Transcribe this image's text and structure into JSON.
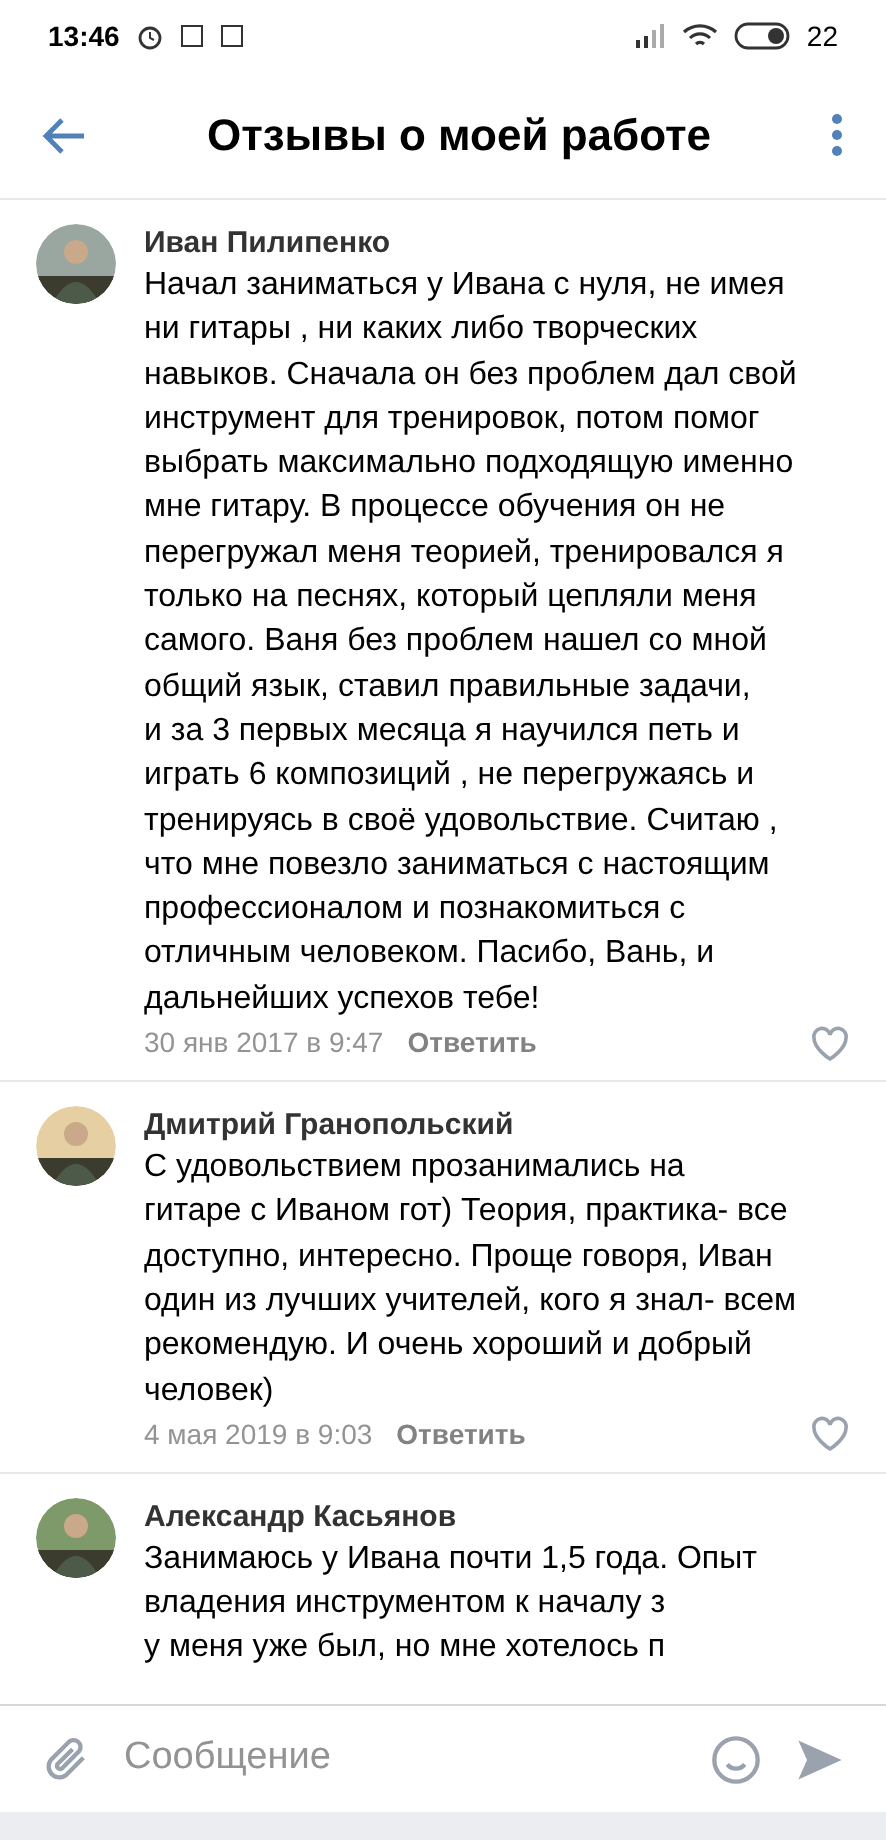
{
  "status_bar": {
    "time": "13:46",
    "battery": "22"
  },
  "header": {
    "title": "Отзывы о моей работе"
  },
  "comments": [
    {
      "author": "Иван Пилипенко",
      "lines": [
        "Начал заниматься у Ивана с нуля, не имея",
        "ни гитары , ни каких либо творческих",
        "навыков. Сначала он без проблем дал свой",
        "инструмент для тренировок, потом помог",
        "выбрать максимально подходящую именно",
        "мне гитару. В процессе обучения он не",
        "перегружал меня теорией, тренировался я",
        "только на песнях, который цепляли меня",
        "самого. Ваня без проблем нашел со мной",
        "общий язык, ставил правильные задачи,",
        "и за 3 первых месяца я научился петь и",
        "играть 6 композиций , не перегружаясь и",
        "тренируясь в своё удовольствие.  Считаю ,",
        "что мне повезло заниматься с настоящим",
        "профессионалом и познакомиться с",
        "отличным человеком. Пасибо, Вань, и",
        "дальнейших успехов тебе!"
      ],
      "date": "30 янв 2017 в 9:47",
      "reply": "Ответить",
      "liked": false
    },
    {
      "author": "Дмитрий Гранопольский",
      "lines": [
        "С удовольствием прозанимались на",
        "гитаре с Иваном гот) Теория, практика- все",
        "доступно, интересно. Проще говоря, Иван",
        "один из лучших учителей, кого я знал- всем",
        "рекомендую. И очень хороший и добрый",
        "человек)"
      ],
      "date": "4 мая 2019 в 9:03",
      "reply": "Ответить",
      "liked": false
    },
    {
      "author": "Александр Касьянов",
      "lines": [
        "Занимаюсь у Ивана почти 1,5 года. Опыт",
        "владения инструментом к началу з",
        "у меня уже был, но мне хотелось п"
      ]
    }
  ],
  "composer": {
    "placeholder": "Сообщение"
  }
}
